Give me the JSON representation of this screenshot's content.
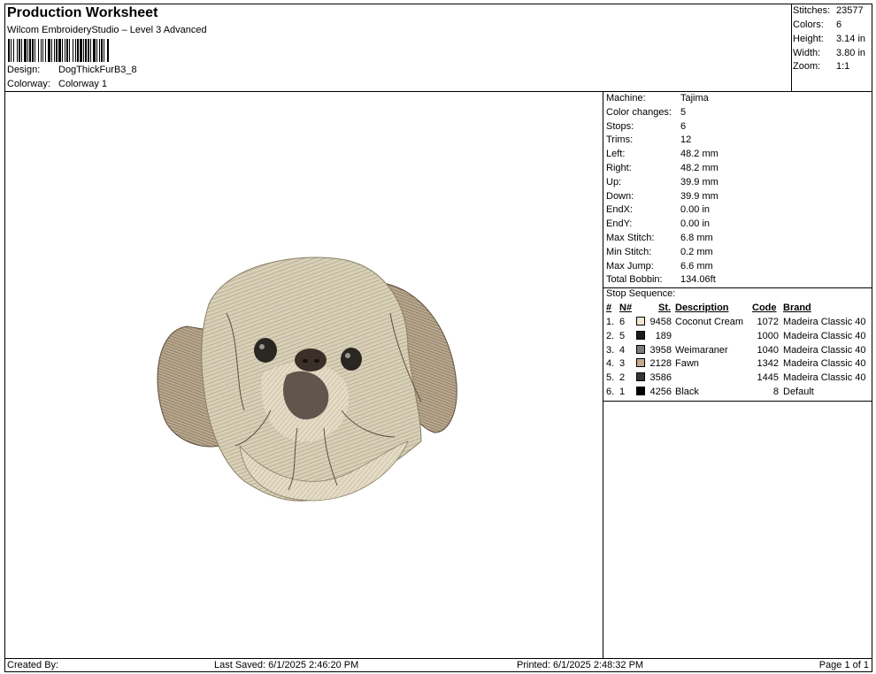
{
  "header": {
    "title": "Production Worksheet",
    "subtitle": "Wilcom EmbroideryStudio – Level 3 Advanced",
    "design_label": "Design:",
    "design_value": "DogThickFurB3_8",
    "colorway_label": "Colorway:",
    "colorway_value": "Colorway 1"
  },
  "stats": {
    "stitches_label": "Stitches:",
    "stitches": "23577",
    "colors_label": "Colors:",
    "colors": "6",
    "height_label": "Height:",
    "height": "3.14 in",
    "width_label": "Width:",
    "width": "3.80 in",
    "zoom_label": "Zoom:",
    "zoom": "1:1"
  },
  "machine_info": [
    {
      "label": "Machine:",
      "value": "Tajima"
    },
    {
      "label": "Color changes:",
      "value": "5"
    },
    {
      "label": "Stops:",
      "value": "6"
    },
    {
      "label": "Trims:",
      "value": "12"
    },
    {
      "label": "Left:",
      "value": "48.2 mm"
    },
    {
      "label": "Right:",
      "value": "48.2 mm"
    },
    {
      "label": "Up:",
      "value": "39.9 mm"
    },
    {
      "label": "Down:",
      "value": "39.9 mm"
    },
    {
      "label": "EndX:",
      "value": "0.00 in"
    },
    {
      "label": "EndY:",
      "value": "0.00 in"
    },
    {
      "label": "Max Stitch:",
      "value": "6.8 mm"
    },
    {
      "label": "Min Stitch:",
      "value": "0.2 mm"
    },
    {
      "label": "Max Jump:",
      "value": "6.6 mm"
    },
    {
      "label": "Total Bobbin:",
      "value": "134.06ft"
    }
  ],
  "stop_sequence": {
    "title": "Stop Sequence:",
    "headers": {
      "num": "#",
      "n": "N#",
      "st": "St.",
      "desc": "Description",
      "code": "Code",
      "brand": "Brand"
    },
    "rows": [
      {
        "num": "1.",
        "n": "6",
        "color": "#f2e4d2",
        "st": "9458",
        "desc": "Coconut Cream",
        "code": "1072",
        "brand": "Madeira Classic 40"
      },
      {
        "num": "2.",
        "n": "5",
        "color": "#1c1c1c",
        "st": "189",
        "desc": "",
        "code": "1000",
        "brand": "Madeira Classic 40"
      },
      {
        "num": "3.",
        "n": "4",
        "color": "#7d7c78",
        "st": "3958",
        "desc": "Weimaraner",
        "code": "1040",
        "brand": "Madeira Classic 40"
      },
      {
        "num": "4.",
        "n": "3",
        "color": "#c5a78a",
        "st": "2128",
        "desc": "Fawn",
        "code": "1342",
        "brand": "Madeira Classic 40"
      },
      {
        "num": "5.",
        "n": "2",
        "color": "#3d3532",
        "st": "3586",
        "desc": "",
        "code": "1445",
        "brand": "Madeira Classic 40"
      },
      {
        "num": "6.",
        "n": "1",
        "color": "#000000",
        "st": "4256",
        "desc": "Black",
        "code": "8",
        "brand": "Default"
      }
    ]
  },
  "footer": {
    "created_by": "Created By:",
    "last_saved": "Last Saved: 6/1/2025 2:46:20 PM",
    "printed": "Printed: 6/1/2025 2:48:32 PM",
    "page": "Page 1 of 1"
  },
  "design_preview": {
    "icon": "embroidered-dog-face"
  }
}
